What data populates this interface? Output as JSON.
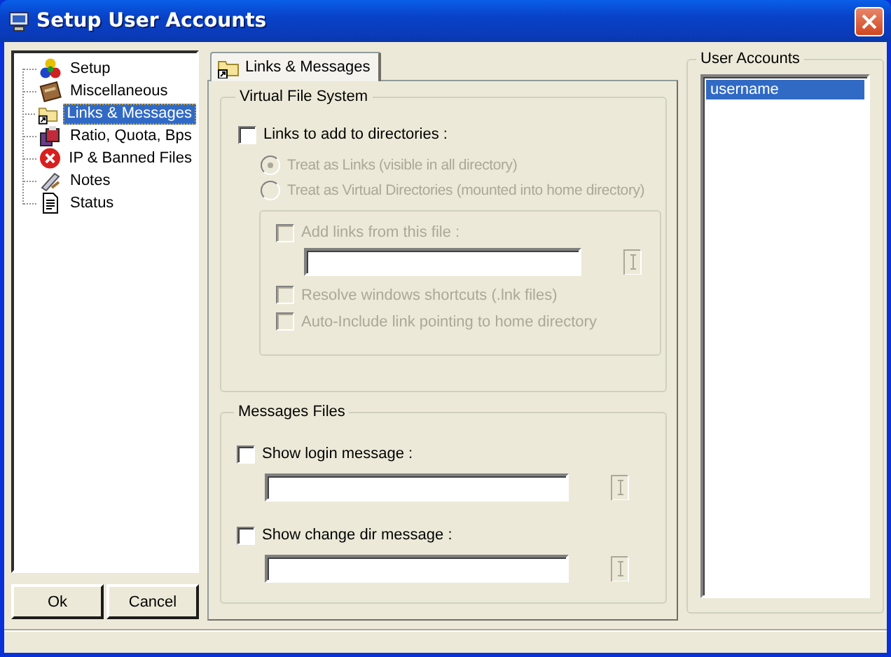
{
  "window": {
    "title": "Setup User Accounts"
  },
  "tree": [
    {
      "label": "Setup",
      "selected": false
    },
    {
      "label": "Miscellaneous",
      "selected": false
    },
    {
      "label": "Links & Messages",
      "selected": true
    },
    {
      "label": "Ratio, Quota, Bps",
      "selected": false
    },
    {
      "label": "IP & Banned Files",
      "selected": false
    },
    {
      "label": "Notes",
      "selected": false
    },
    {
      "label": "Status",
      "selected": false
    }
  ],
  "buttons": [
    "Ok",
    "Cancel"
  ],
  "tab": {
    "label": "Links & Messages",
    "selected": true
  },
  "virtual_file_system": {
    "title": "Virtual File System",
    "links_checkbox": {
      "label": "Links to add to directories :",
      "checked": false,
      "disabled": false
    },
    "radios": [
      {
        "label": "Treat as Links (visible in all directory)",
        "selected": true,
        "disabled": true
      },
      {
        "label": "Treat as Virtual Directories (mounted into home directory)",
        "selected": false,
        "disabled": true
      }
    ],
    "options": [
      {
        "kind": "checkbox-field",
        "label": "Add links from this file :",
        "checked": false,
        "disabled": true
      },
      {
        "kind": "checkbox",
        "label": "Resolve windows shortcuts (.lnk files)",
        "checked": false,
        "disabled": true
      },
      {
        "kind": "checkbox",
        "label": "Auto-Include link pointing to home directory",
        "checked": false,
        "disabled": true
      }
    ]
  },
  "messages_files": {
    "title": "Messages Files",
    "options": [
      {
        "kind": "checkbox-field",
        "label": "Show login message :",
        "checked": false,
        "disabled": false
      },
      {
        "kind": "checkbox-field",
        "label": "Show change dir message :",
        "checked": false,
        "disabled": false
      }
    ]
  },
  "user_accounts": {
    "title": "User Accounts",
    "users": [
      {
        "label": "username",
        "selected": true
      }
    ]
  }
}
